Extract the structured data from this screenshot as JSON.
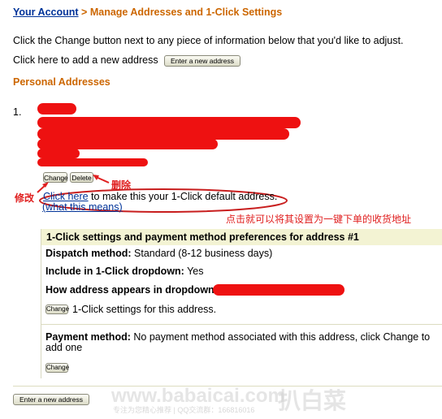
{
  "breadcrumb": {
    "parent": "Your Account",
    "separator": ">",
    "current": "Manage Addresses and 1-Click Settings"
  },
  "intro": "Click the Change button next to any piece of information below that you'd like to adjust.",
  "add_address": {
    "text": "Click here to add a new address",
    "button_label": "Enter a new address"
  },
  "personal_addresses": {
    "heading": "Personal Addresses",
    "entry_number": "1.",
    "change_button": "Change",
    "delete_button": "Delete",
    "default_link": "Click here",
    "default_text": " to make this your 1-Click default address.",
    "what_this_means": "(what this means)"
  },
  "annotations": {
    "modify": "修改",
    "delete": "删除",
    "hint": "点击就可以将其设置为一键下单的收货地址",
    "color": "#e02020"
  },
  "one_click_panel": {
    "header": "1-Click settings and payment method preferences for address #1",
    "dispatch_label": "Dispatch method:",
    "dispatch_value": " Standard (8-12 business days)",
    "include_label": "Include in 1-Click dropdown:",
    "include_value": " Yes",
    "appears_label": "How address appears in dropdown:",
    "settings_change_button": "Change",
    "settings_text": "1-Click settings for this address.",
    "payment_label": "Payment method:",
    "payment_value": " No payment method associated with this address, click Change to add one",
    "payment_change_button": "Change"
  },
  "bottom_button": "Enter a new address",
  "watermark": {
    "url": "www.babaicai.com",
    "brand": "扒白菜",
    "sub": "专注为您精心推荐 | QQ交流群：166816016"
  },
  "colors": {
    "link": "#003399",
    "heading_orange": "#cc6600",
    "redaction": "#ee1111",
    "panel_header_bg": "#f3f3d3"
  }
}
